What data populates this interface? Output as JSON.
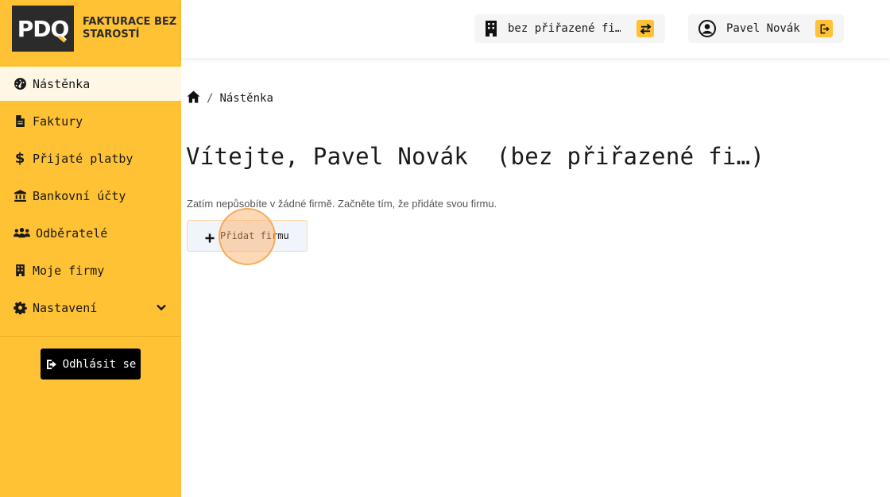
{
  "brand": {
    "logo_text": "PDQ",
    "name": "FAKTURACE BEZ STAROSTÍ"
  },
  "sidebar": {
    "items": [
      {
        "label": "Nástěnka",
        "icon": "dashboard-icon",
        "active": true
      },
      {
        "label": "Faktury",
        "icon": "file-icon"
      },
      {
        "label": "Přijaté platby",
        "icon": "dollar-icon"
      },
      {
        "label": "Bankovní účty",
        "icon": "bank-icon"
      },
      {
        "label": "Odběratelé",
        "icon": "users-icon"
      },
      {
        "label": "Moje firmy",
        "icon": "building-icon"
      },
      {
        "label": "Nastavení",
        "icon": "gear-icon",
        "expandable": true
      }
    ],
    "logout_label": "Odhlásit se"
  },
  "header": {
    "company": "bez přiřazené fi…",
    "user_name": "Pavel Novák"
  },
  "main": {
    "breadcrumb": [
      "Nástěnka"
    ],
    "title": "Vítejte, Pavel Novák  (bez přiřazené fi…)",
    "info": "Zatím nepůsobíte v žádné firmě. Začněte tím, že přidáte svou firmu.",
    "add_company_label": "Přidat firmu"
  },
  "colors": {
    "accent": "#ffc234",
    "active_item": "#fff7e6",
    "logo_bg": "#2b2b2b"
  }
}
